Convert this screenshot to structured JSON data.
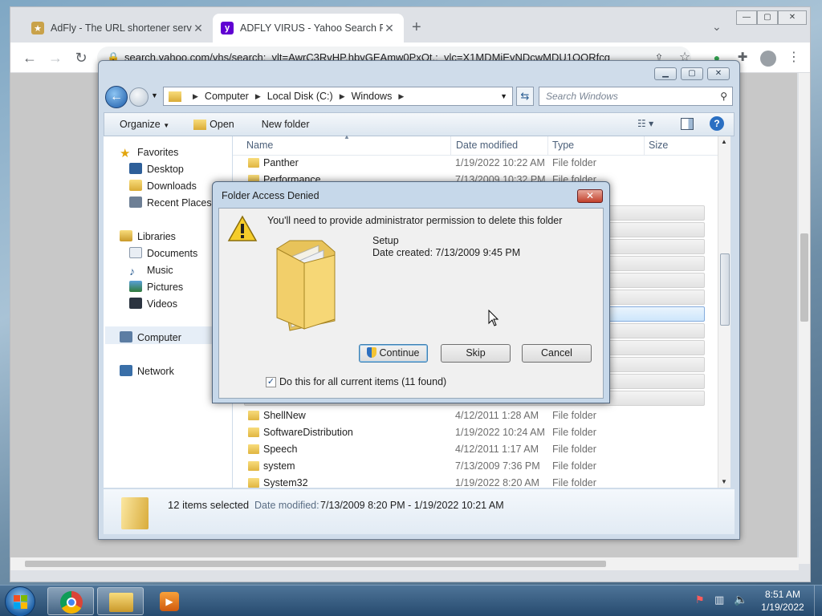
{
  "browser": {
    "tabs": [
      {
        "title": "AdFly - The URL shortener servic",
        "active": false
      },
      {
        "title": "ADFLY VIRUS - Yahoo Search Res",
        "active": true
      }
    ],
    "url": "search.yahoo.com/yhs/search;_ylt=AwrC3RvHP.hbyGEAmw0PxQt.;_ylc=X1MDMjEyNDcwMDU1OQRfcg"
  },
  "explorer": {
    "breadcrumb": [
      "Computer",
      "Local Disk (C:)",
      "Windows"
    ],
    "search_placeholder": "Search Windows",
    "commands": {
      "organize": "Organize",
      "open": "Open",
      "new_folder": "New folder"
    },
    "nav": {
      "favorites": "Favorites",
      "desktop": "Desktop",
      "downloads": "Downloads",
      "recent": "Recent Places",
      "libraries": "Libraries",
      "documents": "Documents",
      "music": "Music",
      "pictures": "Pictures",
      "videos": "Videos",
      "computer": "Computer",
      "network": "Network"
    },
    "columns": {
      "name": "Name",
      "date": "Date modified",
      "type": "Type",
      "size": "Size"
    },
    "rows_top": [
      {
        "name": "Panther",
        "date": "1/19/2022 10:22 AM",
        "type": "File folder"
      },
      {
        "name": "Performance",
        "date": "7/13/2009 10:32 PM",
        "type": "File folder"
      }
    ],
    "rows_bottom": [
      {
        "name": "ShellNew",
        "date": "4/12/2011 1:28 AM",
        "type": "File folder"
      },
      {
        "name": "SoftwareDistribution",
        "date": "1/19/2022 10:24 AM",
        "type": "File folder"
      },
      {
        "name": "Speech",
        "date": "4/12/2011 1:17 AM",
        "type": "File folder"
      },
      {
        "name": "system",
        "date": "7/13/2009 7:36 PM",
        "type": "File folder"
      },
      {
        "name": "System32",
        "date": "1/19/2022 8:20 AM",
        "type": "File folder"
      }
    ],
    "details": {
      "count": "12 items selected",
      "label": "Date modified:",
      "value": "7/13/2009 8:20 PM - 1/19/2022 10:21 AM"
    }
  },
  "dialog": {
    "title": "Folder Access Denied",
    "message": "You'll need to provide administrator permission to delete this folder",
    "folder_name": "Setup",
    "date_created": "Date created: 7/13/2009 9:45 PM",
    "continue": "Continue",
    "skip": "Skip",
    "cancel": "Cancel",
    "apply_all": "Do this for all current items (11 found)",
    "apply_all_checked": true
  },
  "taskbar": {
    "time": "8:51 AM",
    "date": "1/19/2022"
  }
}
